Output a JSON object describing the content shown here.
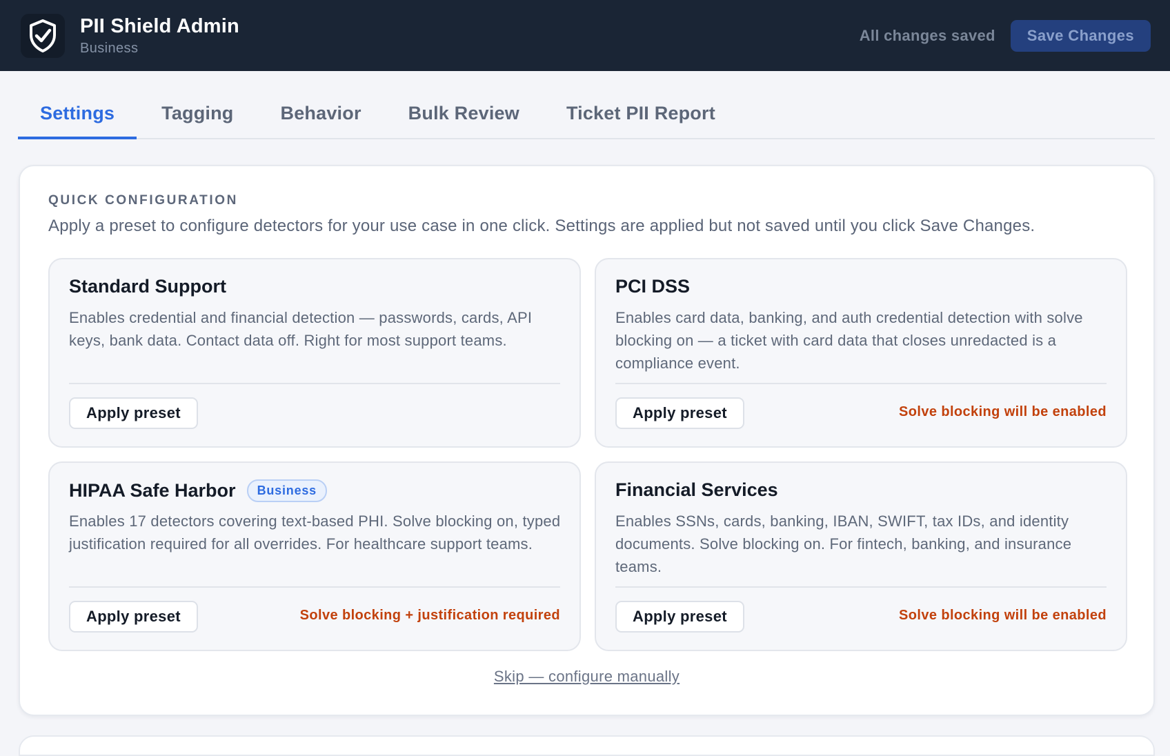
{
  "header": {
    "app_title": "PII Shield Admin",
    "plan": "Business",
    "logo_icon": "shield-check-icon",
    "status": "All changes saved",
    "save_label": "Save Changes"
  },
  "tabs": [
    {
      "label": "Settings",
      "active": true
    },
    {
      "label": "Tagging",
      "active": false
    },
    {
      "label": "Behavior",
      "active": false
    },
    {
      "label": "Bulk Review",
      "active": false
    },
    {
      "label": "Ticket PII Report",
      "active": false
    }
  ],
  "quick_config": {
    "heading": "QUICK CONFIGURATION",
    "description": "Apply a preset to configure detectors for your use case in one click. Settings are applied but not saved until you click Save Changes.",
    "presets": [
      {
        "title": "Standard Support",
        "description": "Enables credential and financial detection — passwords, cards, API keys, bank data. Contact data off. Right for most support teams.",
        "button": "Apply preset",
        "note": ""
      },
      {
        "title": "PCI DSS",
        "description": "Enables card data, banking, and auth credential detection with solve blocking on — a ticket with card data that closes unredacted is a compliance event.",
        "button": "Apply preset",
        "note": "Solve blocking will be enabled"
      },
      {
        "title": "HIPAA Safe Harbor",
        "badge": "Business",
        "description": "Enables 17 detectors covering text-based PHI. Solve blocking on, typed justification required for all overrides. For healthcare support teams.",
        "button": "Apply preset",
        "note": "Solve blocking + justification required"
      },
      {
        "title": "Financial Services",
        "description": "Enables SSNs, cards, banking, IBAN, SWIFT, tax IDs, and identity documents. Solve blocking on. For fintech, banking, and insurance teams.",
        "button": "Apply preset",
        "note": "Solve blocking will be enabled"
      }
    ],
    "skip_label": "Skip — configure manually"
  },
  "colors": {
    "header_bg": "#1a2535",
    "accent": "#2d6be0",
    "warning": "#c2410c"
  }
}
